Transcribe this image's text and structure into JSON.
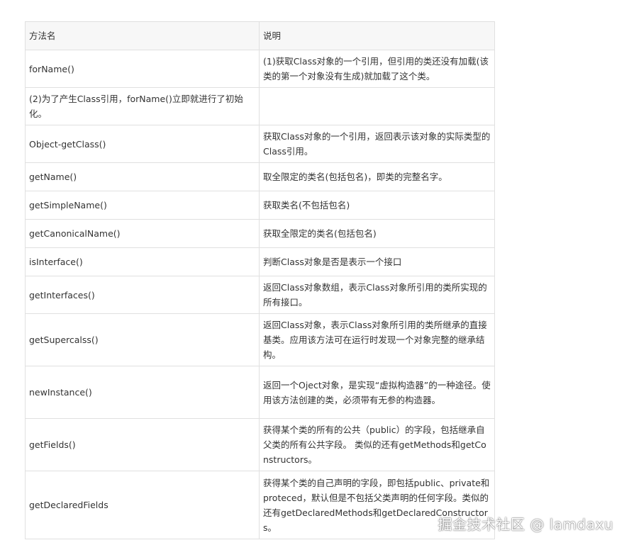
{
  "table": {
    "header": {
      "method": "方法名",
      "description": "说明"
    },
    "rows": [
      {
        "method": "forName()",
        "description": "(1)获取Class对象的一个引用，但引用的类还没有加载(该类的第一个对象没有生成)就加载了这个类。"
      },
      {
        "method": "(2)为了产生Class引用，forName()立即就进行了初始化。",
        "description": ""
      },
      {
        "method": "Object-getClass()",
        "description": "获取Class对象的一个引用，返回表示该对象的实际类型的Class引用。"
      },
      {
        "method": "getName()",
        "description": "取全限定的类名(包括包名)，即类的完整名字。"
      },
      {
        "method": "getSimpleName()",
        "description": "获取类名(不包括包名)"
      },
      {
        "method": "getCanonicalName()",
        "description": "获取全限定的类名(包括包名)"
      },
      {
        "method": "isInterface()",
        "description": "判断Class对象是否是表示一个接口"
      },
      {
        "method": "getInterfaces()",
        "description": "返回Class对象数组，表示Class对象所引用的类所实现的所有接口。"
      },
      {
        "method": "getSupercalss()",
        "description": "返回Class对象，表示Class对象所引用的类所继承的直接基类。应用该方法可在运行时发现一个对象完整的继承结构。"
      },
      {
        "method": "newInstance()",
        "description": "返回一个Oject对象，是实现“虚拟构造器”的一种途径。使用该方法创建的类，必须带有无参的构造器。"
      },
      {
        "method": "getFields()",
        "description": "获得某个类的所有的公共（public）的字段，包括继承自父类的所有公共字段。 类似的还有getMethods和getConstructors。"
      },
      {
        "method": "getDeclaredFields",
        "description": "获得某个类的自己声明的字段，即包括public、private和proteced，默认但是不包括父类声明的任何字段。类似的还有getDeclaredMethods和getDeclaredConstructors。"
      }
    ]
  },
  "watermark": "掘金技术社区 @ lamdaxu"
}
